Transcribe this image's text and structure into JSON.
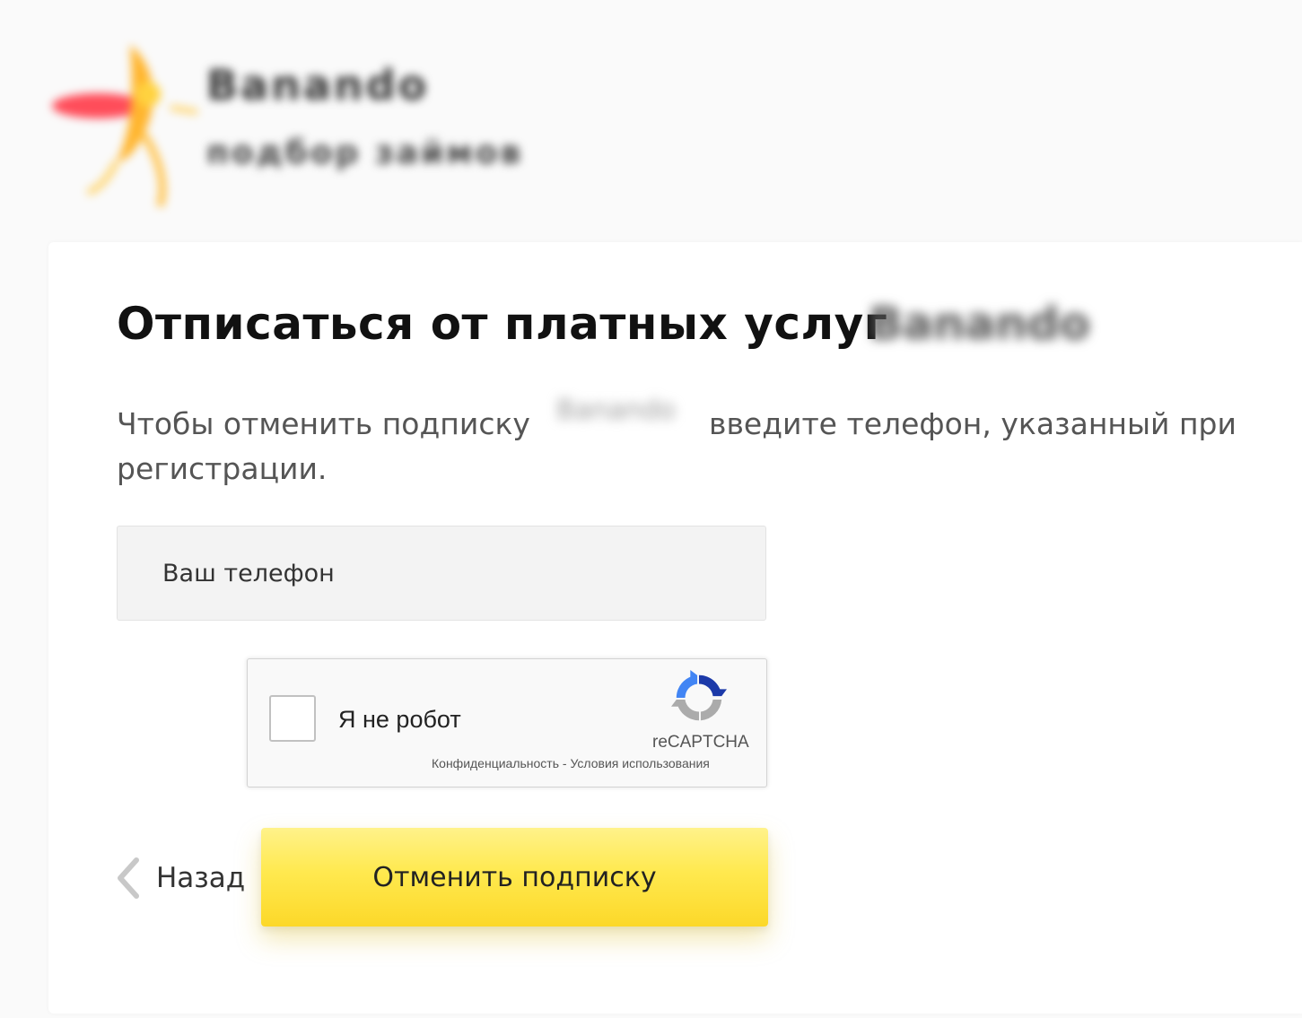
{
  "header": {
    "brand_name": "Banando",
    "tagline": "подбор займов"
  },
  "form": {
    "title": "Отписаться от платных услуг",
    "title_brand": "Banando",
    "description_part1": "Чтобы отменить подписку",
    "description_brand": "Banando",
    "description_part2": "введите телефон, указанный при",
    "description_line2": "регистрации.",
    "phone_placeholder": "Ваш телефон",
    "phone_value": ""
  },
  "recaptcha": {
    "label": "Я не робот",
    "brand": "reCAPTCHA",
    "privacy": "Конфиденциальность",
    "separator": " - ",
    "terms": "Условия использования",
    "checked": false
  },
  "actions": {
    "back_label": "Назад",
    "submit_label": "Отменить подписку"
  },
  "colors": {
    "page_background": "#fafafa",
    "card_background": "#ffffff",
    "button_yellow": "#ffe94f",
    "input_background": "#f3f3f3"
  },
  "icons": {
    "logo": "banana-logo-icon",
    "recaptcha": "recaptcha-logo-icon",
    "back": "chevron-left-icon"
  }
}
